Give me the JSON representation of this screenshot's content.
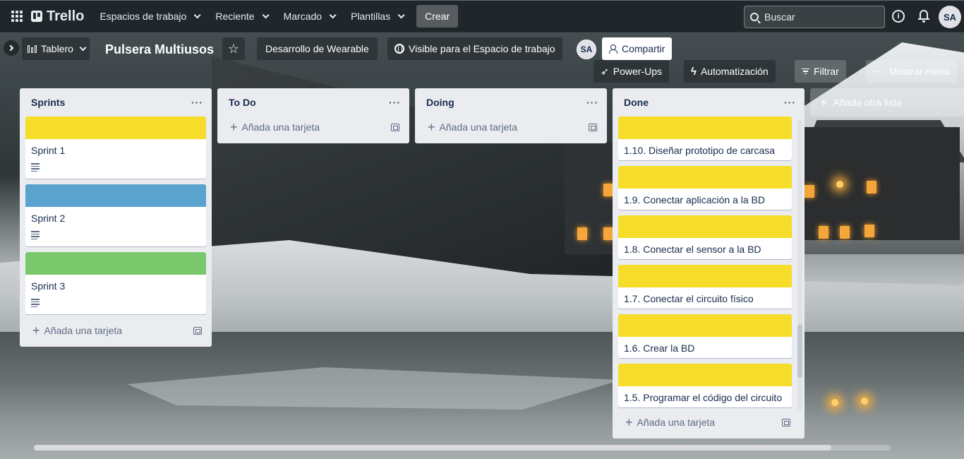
{
  "nav": {
    "logo": "Trello",
    "workspaces": "Espacios de trabajo",
    "recent": "Reciente",
    "starred": "Marcado",
    "templates": "Plantillas",
    "create": "Crear",
    "search_placeholder": "Buscar",
    "info_glyph": "i",
    "avatar": "SA"
  },
  "board": {
    "view": "Tablero",
    "title": "Pulsera Multiusos",
    "workspace": "Desarrollo de Wearable",
    "visibility": "Visible para el Espacio de trabajo",
    "member": "SA",
    "share": "Compartir",
    "powerups": "Power-Ups",
    "automation": "Automatización",
    "filter": "Filtrar",
    "menu": "Mostrar menú",
    "add_list": "Añada otra lista",
    "add_card": "Añada una tarjeta"
  },
  "lists": {
    "sprints": {
      "title": "Sprints",
      "cards": [
        {
          "title": "Sprint 1",
          "cover": "#f5dd29"
        },
        {
          "title": "Sprint 2",
          "cover": "#5aa3cf"
        },
        {
          "title": "Sprint 3",
          "cover": "#7bc86c"
        }
      ]
    },
    "todo": {
      "title": "To Do"
    },
    "doing": {
      "title": "Doing"
    },
    "done": {
      "title": "Done",
      "cards": [
        {
          "title": "1.10. Diseñar prototipo de carcasa",
          "cover": "#f5dd29"
        },
        {
          "title": "1.9. Conectar aplicación a la BD",
          "cover": "#f5dd29"
        },
        {
          "title": "1.8. Conectar el sensor a la BD",
          "cover": "#f5dd29"
        },
        {
          "title": "1.7. Conectar el circuito físico",
          "cover": "#f5dd29"
        },
        {
          "title": "1.6. Crear la BD",
          "cover": "#f5dd29"
        },
        {
          "title": "1.5. Programar el código del circuito",
          "cover": "#f5dd29"
        }
      ]
    }
  },
  "colors": {
    "list_bg": "#ebecf0",
    "text": "#172b4d",
    "nav_bg": "#1a2024"
  }
}
